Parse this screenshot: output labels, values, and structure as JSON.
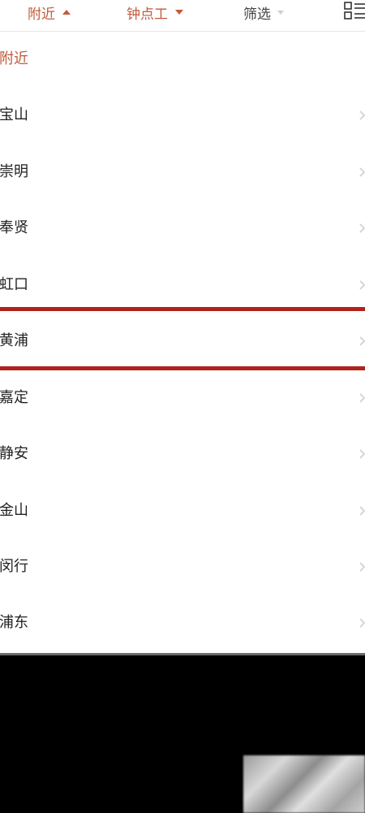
{
  "filter_bar": {
    "tabs": [
      {
        "label": "附近",
        "state": "open"
      },
      {
        "label": "钟点工",
        "state": "closed"
      },
      {
        "label": "筛选",
        "state": "closed"
      }
    ],
    "layout_icon": "list-layout-icon"
  },
  "district_list": {
    "selected": "附近",
    "items": [
      {
        "label": "附近"
      },
      {
        "label": "宝山"
      },
      {
        "label": "崇明"
      },
      {
        "label": "奉贤"
      },
      {
        "label": "虹口"
      },
      {
        "label": "黄浦"
      },
      {
        "label": "嘉定"
      },
      {
        "label": "静安"
      },
      {
        "label": "金山"
      },
      {
        "label": "闵行"
      },
      {
        "label": "浦东"
      }
    ],
    "highlighted_item": "黄浦"
  },
  "colors": {
    "accent": "#c25a3a",
    "highlight": "#b0231b",
    "text": "#222222"
  }
}
